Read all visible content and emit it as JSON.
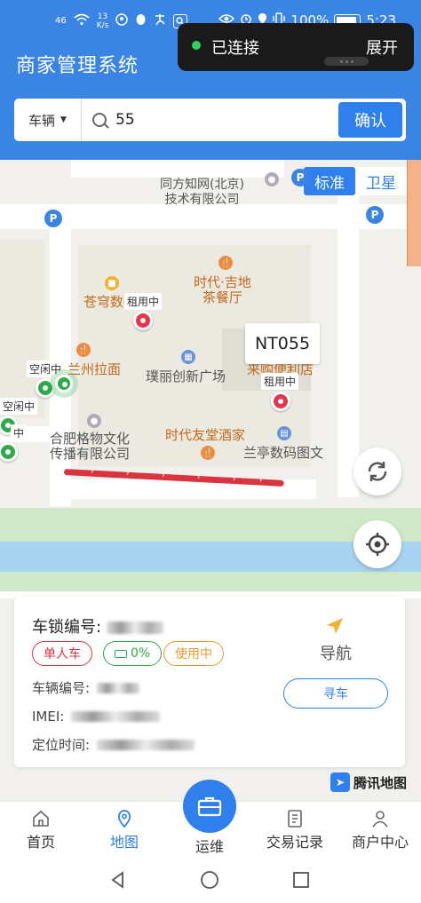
{
  "status_bar": {
    "signal": "46",
    "net_speed_value": "13",
    "net_speed_unit": "K/s",
    "battery_percent": "100%",
    "time": "5:23"
  },
  "header": {
    "title": "商家管理系统"
  },
  "connection": {
    "status": "已连接",
    "expand_label": "展开"
  },
  "search": {
    "vehicle_type": "车辆",
    "query": "55",
    "confirm_label": "确认"
  },
  "map": {
    "type_toggle": {
      "standard": "标准",
      "satellite": "卫星"
    },
    "pois": {
      "tongfang": "同方知网(北京)\n技术有限公司",
      "times_jidi": "时代·吉地\n茶餐厅",
      "cangqiong": "苍穹数码",
      "lanzhou": "兰州拉面",
      "puli": "璞丽创新广场",
      "convenience": "来购便利店",
      "hefei_ge": "合肥格物文化\n传播有限公司",
      "times_friend": "时代友堂酒家",
      "lanting": "兰亭数码图文"
    },
    "markers": {
      "rented_1": "租用中",
      "rented_2": "租用中",
      "idle_1": "空闲中",
      "idle_2": "空闲中",
      "idle_3": "中"
    },
    "selected_bike_label": "NT055",
    "provider": "腾讯地图"
  },
  "lock_card": {
    "lock_number_label": "车锁编号:",
    "tags": {
      "type": "单人车",
      "battery": "0%",
      "status": "使用中"
    },
    "navigate_label": "导航",
    "vehicle_number_label": "车辆编号:",
    "imei_label": "IMEI:",
    "location_time_label": "定位时间:",
    "find_vehicle_label": "寻车"
  },
  "tabbar": {
    "home": "首页",
    "map": "地图",
    "ops": "运维",
    "transactions": "交易记录",
    "merchant": "商户中心"
  },
  "colors": {
    "primary": "#2f80ed",
    "header": "#3a84e4",
    "red": "#d9343f",
    "green": "#2eaa4b",
    "orange": "#e99a2f"
  }
}
